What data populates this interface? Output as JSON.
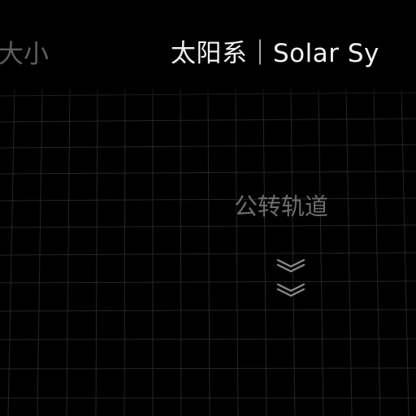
{
  "nav": {
    "size_tab": "大小"
  },
  "header": {
    "title": "太阳系｜Solar Sy"
  },
  "section": {
    "orbit_label": "公转轨道"
  },
  "scroll_hint": {
    "icon": "double-chevron-down-icon"
  },
  "colors": {
    "background": "#000000",
    "title": "#f2f2f2",
    "muted_text": "#6d6d6d",
    "grid": "#2a2a2a"
  }
}
